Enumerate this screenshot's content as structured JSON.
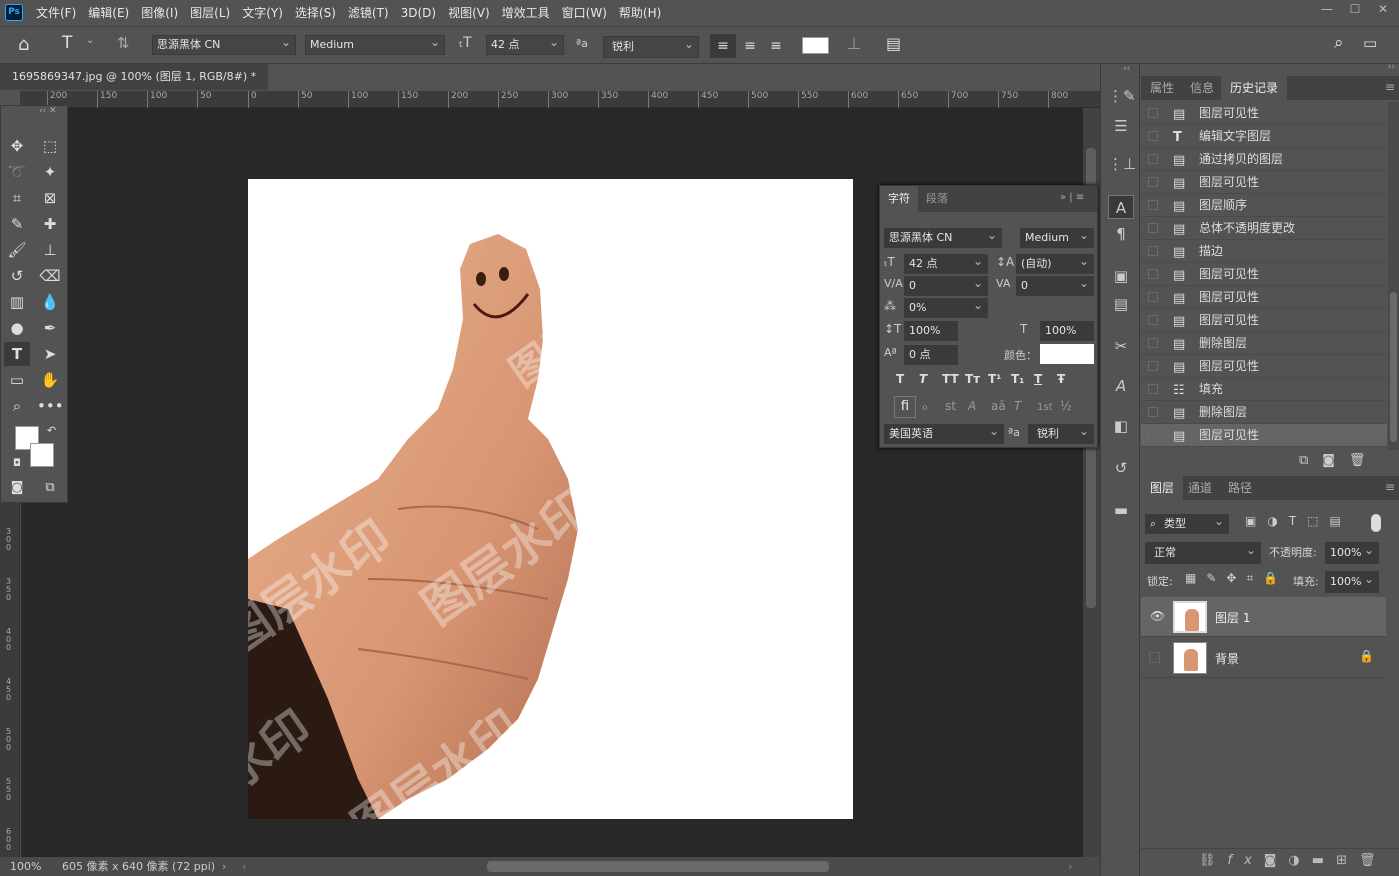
{
  "app": {
    "logo": "Ps"
  },
  "menu": [
    "文件(F)",
    "编辑(E)",
    "图像(I)",
    "图层(L)",
    "文字(Y)",
    "选择(S)",
    "滤镜(T)",
    "3D(D)",
    "视图(V)",
    "增效工具",
    "窗口(W)",
    "帮助(H)"
  ],
  "window_controls": [
    "—",
    "☐",
    "✕"
  ],
  "options": {
    "font_family": "思源黑体 CN",
    "font_style": "Medium",
    "font_size": "42 点",
    "aa_icon": "ªa",
    "antialias": "锐利",
    "text_color": "#ffffff"
  },
  "document": {
    "tab_title": "1695869347.jpg @ 100% (图层 1, RGB/8#) *",
    "close": "×",
    "zoom": "100%",
    "info": "605 像素 x 640 像素 (72 ppi)"
  },
  "ruler": {
    "top": [
      "200",
      "150",
      "100",
      "50",
      "0",
      "50",
      "100",
      "150",
      "200",
      "250",
      "300",
      "350",
      "400",
      "450",
      "500",
      "550",
      "600",
      "650",
      "700",
      "750",
      "800"
    ],
    "left": [
      "3 0 0",
      "3 5 0",
      "4 0 0",
      "4 5 0",
      "5 0 0",
      "5 5 0",
      "6 0 0",
      "6 5 0"
    ]
  },
  "watermark": "图层水印",
  "character_panel": {
    "tabs": [
      "字符",
      "段落"
    ],
    "font_family": "思源黑体 CN",
    "font_style": "Medium",
    "size": "42 点",
    "leading": "(自动)",
    "kerning": "0",
    "tracking": "0",
    "scale_tsume": "0%",
    "vscale": "100%",
    "hscale": "100%",
    "baseline": "0 点",
    "color_label": "颜色：",
    "color": "#ffffff",
    "style_buttons": [
      "T",
      "T",
      "TT",
      "Tт",
      "T¹",
      "T₁",
      "T",
      "Ŧ"
    ],
    "opentype_buttons": [
      "ﬁ",
      "ℴ",
      "st",
      "A",
      "aā",
      "T",
      "1st",
      "½"
    ],
    "language": "美国英语",
    "aa_icon": "ªa",
    "antialias": "锐利"
  },
  "history_panel": {
    "tabs": [
      "属性",
      "信息",
      "历史记录"
    ],
    "active_tab": 2,
    "items": [
      {
        "icon": "doc",
        "label": "图层可见性"
      },
      {
        "icon": "T",
        "label": "编辑文字图层"
      },
      {
        "icon": "doc",
        "label": "通过拷贝的图层"
      },
      {
        "icon": "doc",
        "label": "图层可见性"
      },
      {
        "icon": "doc",
        "label": "图层顺序"
      },
      {
        "icon": "doc",
        "label": "总体不透明度更改"
      },
      {
        "icon": "doc",
        "label": "描边"
      },
      {
        "icon": "doc",
        "label": "图层可见性"
      },
      {
        "icon": "doc",
        "label": "图层可见性"
      },
      {
        "icon": "doc",
        "label": "图层可见性"
      },
      {
        "icon": "doc",
        "label": "删除图层"
      },
      {
        "icon": "doc",
        "label": "图层可见性"
      },
      {
        "icon": "fill",
        "label": "填充"
      },
      {
        "icon": "doc",
        "label": "删除图层"
      },
      {
        "icon": "doc",
        "label": "图层可见性"
      }
    ]
  },
  "layers_panel": {
    "tabs": [
      "图层",
      "通道",
      "路径"
    ],
    "filter": "类型",
    "blend_mode": "正常",
    "opacity_label": "不透明度:",
    "opacity": "100%",
    "lock_label": "锁定:",
    "fill_label": "填充:",
    "fill": "100%",
    "layers": [
      {
        "name": "图层 1",
        "visible": true,
        "selected": true
      },
      {
        "name": "背景",
        "visible": false,
        "locked": true
      }
    ],
    "bottom_icons": [
      "link-icon",
      "fx-icon",
      "mask-icon",
      "adjustment-icon",
      "group-icon",
      "new-layer-icon",
      "trash-icon"
    ]
  }
}
